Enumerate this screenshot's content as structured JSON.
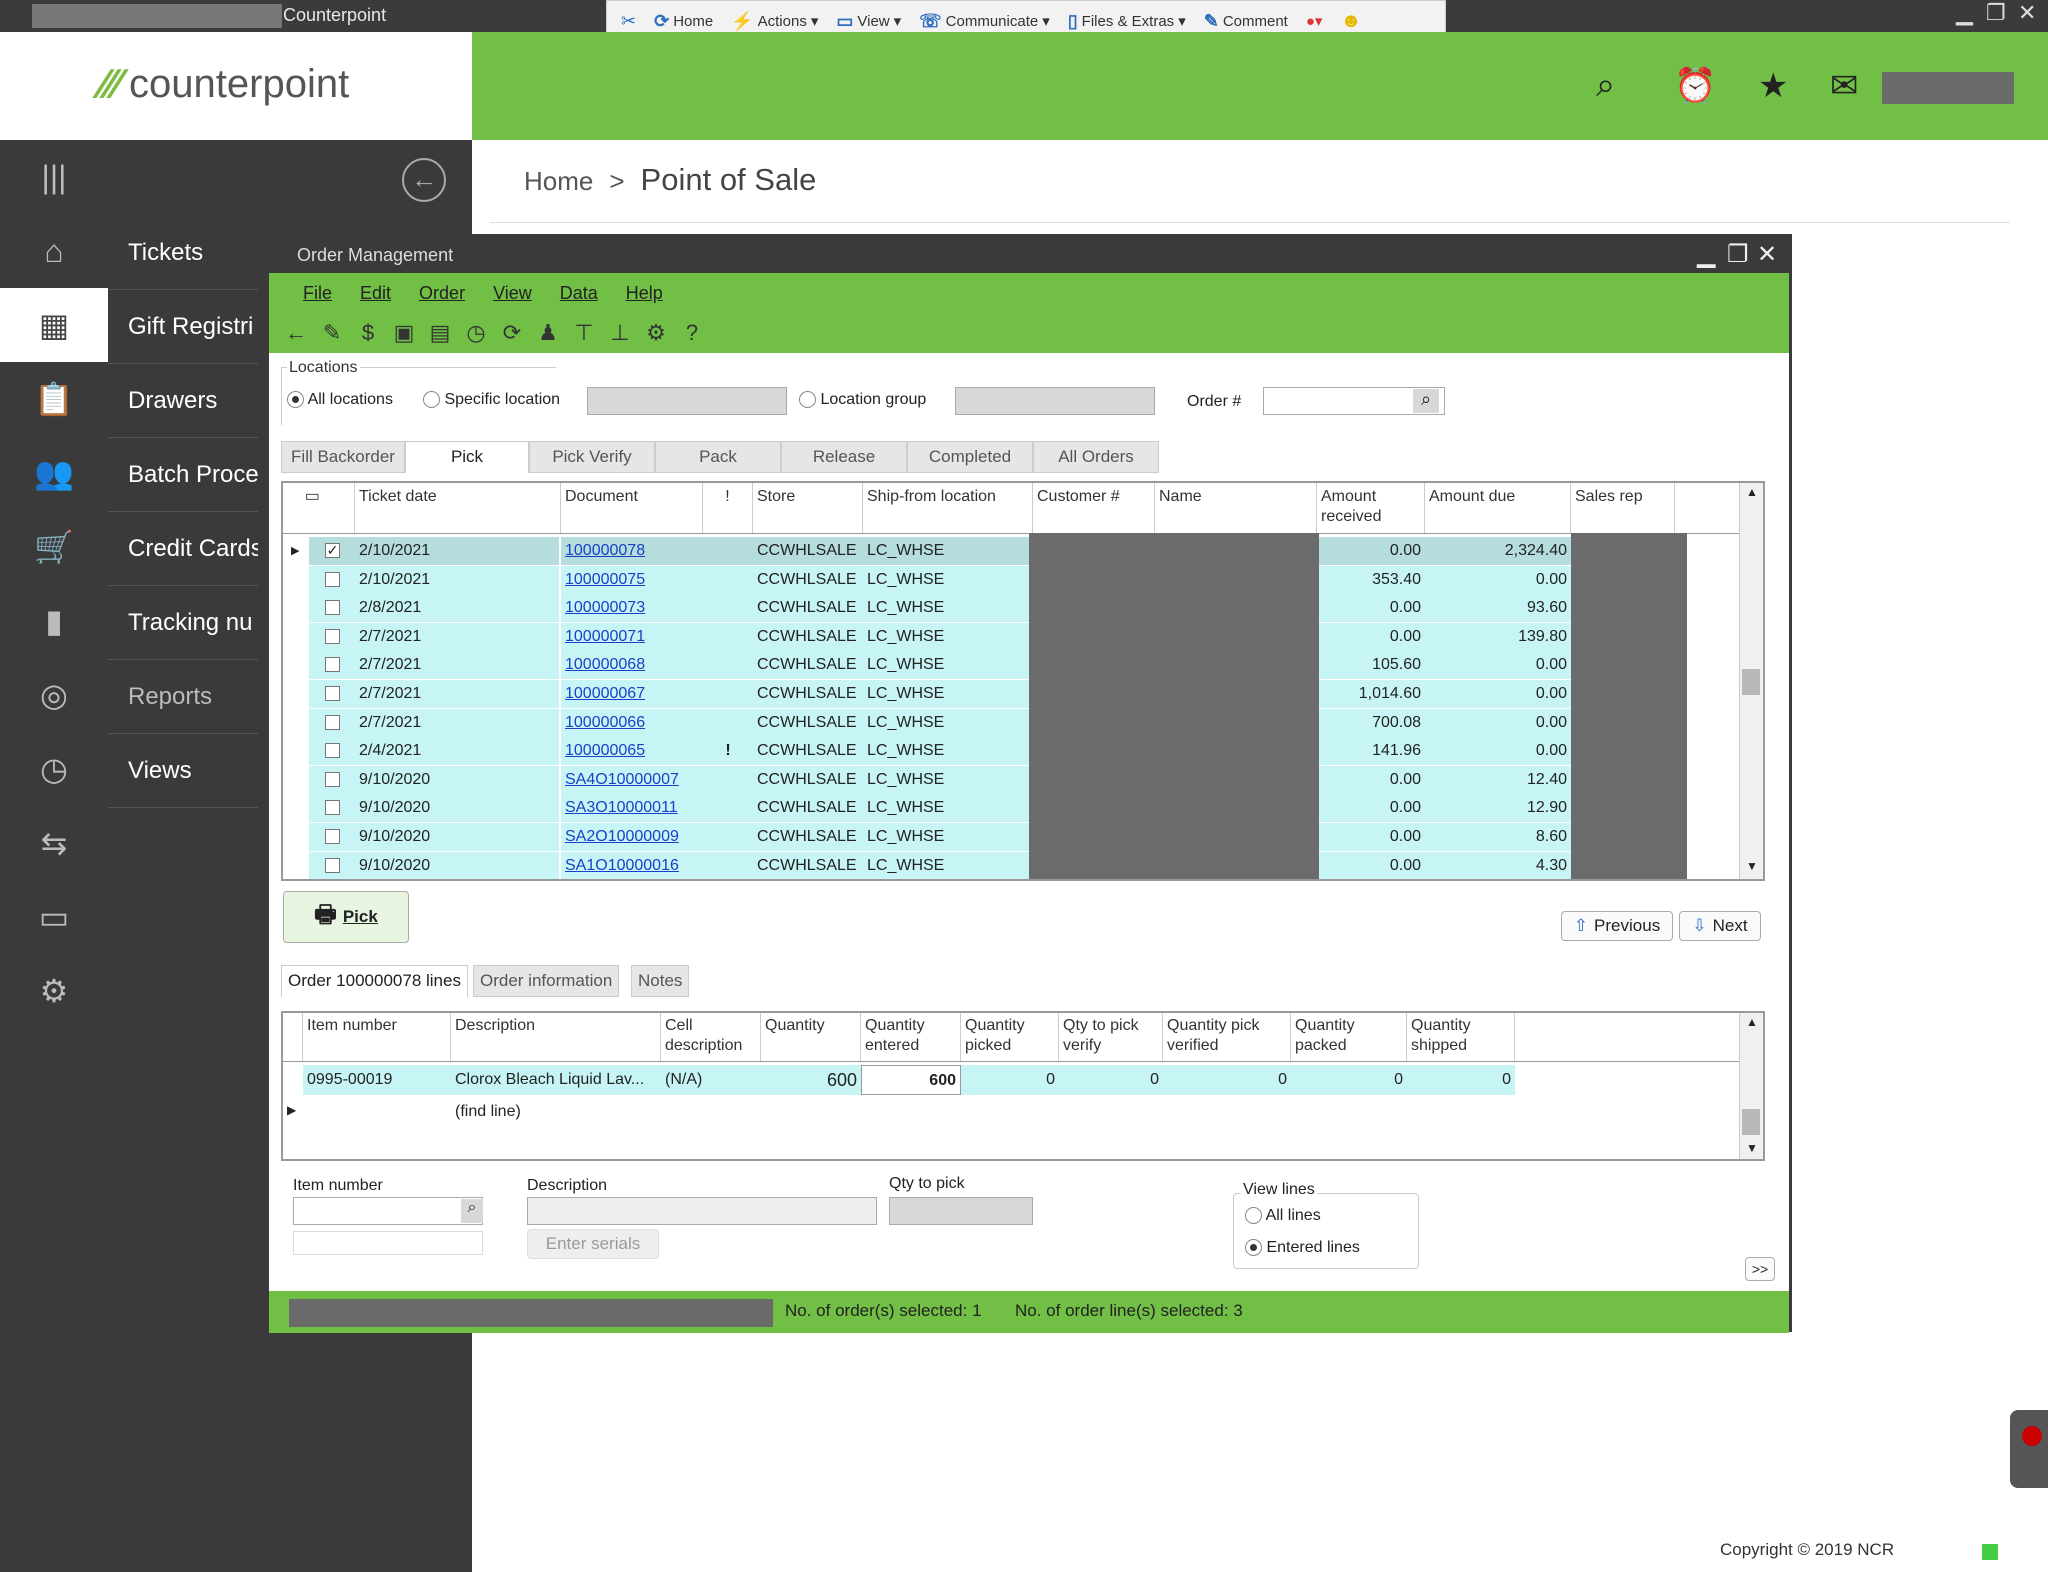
{
  "window": {
    "app_title": "Counterpoint",
    "min": "▁",
    "max": "❐",
    "close": "✕"
  },
  "ctoolbar": {
    "items": [
      "Home",
      "Actions",
      "View",
      "Communicate",
      "Files & Extras",
      "Comment"
    ]
  },
  "logo": {
    "text": "counterpoint",
    "mark": "⁄⁄⁄"
  },
  "header": {
    "icons": [
      "search-icon",
      "alarm-icon",
      "star-icon",
      "mail-icon"
    ]
  },
  "rail": {
    "items": [
      {
        "icon": "menu-icon",
        "glyph": "|||"
      },
      {
        "icon": "home-icon",
        "glyph": "⌂"
      },
      {
        "icon": "register-icon",
        "glyph": "▦"
      },
      {
        "icon": "clipboard-icon",
        "glyph": "📋"
      },
      {
        "icon": "customers-icon",
        "glyph": "👥"
      },
      {
        "icon": "cart-icon",
        "glyph": "🛒"
      },
      {
        "icon": "chart-icon",
        "glyph": "▮"
      },
      {
        "icon": "reports-icon",
        "glyph": "◎"
      },
      {
        "icon": "clock-icon",
        "glyph": "◷"
      },
      {
        "icon": "transfer-icon",
        "glyph": "⇆"
      },
      {
        "icon": "laptop-icon",
        "glyph": "▭"
      },
      {
        "icon": "settings-icon",
        "glyph": "⚙"
      }
    ]
  },
  "nav": {
    "items": [
      "Tickets",
      "Gift Registri",
      "Drawers",
      "Batch Proce",
      "Credit Cards",
      "Tracking nu",
      "Reports",
      "Views"
    ]
  },
  "breadcrumb": {
    "home": "Home",
    "sep": ">",
    "current": "Point of Sale"
  },
  "om": {
    "title": "Order Management",
    "menu": [
      "File",
      "Edit",
      "Order",
      "View",
      "Data",
      "Help"
    ],
    "locations_label": "Locations",
    "all_locations": "All locations",
    "specific_location": "Specific location",
    "location_group": "Location group",
    "order_label": "Order #",
    "tabs": [
      "Fill Backorder",
      "Pick",
      "Pick Verify",
      "Pack",
      "Release",
      "Completed",
      "All Orders"
    ],
    "columns": [
      "Ticket date",
      "Document",
      "!",
      "Store",
      "Ship-from location",
      "Customer #",
      "Name",
      "Amount received",
      "Amount due",
      "Sales rep"
    ],
    "rows": [
      {
        "date": "2/10/2021",
        "doc": "100000078",
        "flag": "",
        "store": "CCWHLSALE",
        "loc": "LC_WHSE",
        "recv": "0.00",
        "due": "2,324.40",
        "checked": "✓"
      },
      {
        "date": "2/10/2021",
        "doc": "100000075",
        "flag": "",
        "store": "CCWHLSALE",
        "loc": "LC_WHSE",
        "recv": "353.40",
        "due": "0.00",
        "checked": ""
      },
      {
        "date": "2/8/2021",
        "doc": "100000073",
        "flag": "",
        "store": "CCWHLSALE",
        "loc": "LC_WHSE",
        "recv": "0.00",
        "due": "93.60",
        "checked": ""
      },
      {
        "date": "2/7/2021",
        "doc": "100000071",
        "flag": "",
        "store": "CCWHLSALE",
        "loc": "LC_WHSE",
        "recv": "0.00",
        "due": "139.80",
        "checked": ""
      },
      {
        "date": "2/7/2021",
        "doc": "100000068",
        "flag": "",
        "store": "CCWHLSALE",
        "loc": "LC_WHSE",
        "recv": "105.60",
        "due": "0.00",
        "checked": ""
      },
      {
        "date": "2/7/2021",
        "doc": "100000067",
        "flag": "",
        "store": "CCWHLSALE",
        "loc": "LC_WHSE",
        "recv": "1,014.60",
        "due": "0.00",
        "checked": ""
      },
      {
        "date": "2/7/2021",
        "doc": "100000066",
        "flag": "",
        "store": "CCWHLSALE",
        "loc": "LC_WHSE",
        "recv": "700.08",
        "due": "0.00",
        "checked": ""
      },
      {
        "date": "2/4/2021",
        "doc": "100000065",
        "flag": "!",
        "store": "CCWHLSALE",
        "loc": "LC_WHSE",
        "recv": "141.96",
        "due": "0.00",
        "checked": ""
      },
      {
        "date": "9/10/2020",
        "doc": "SA4O10000007",
        "flag": "",
        "store": "CCWHLSALE",
        "loc": "LC_WHSE",
        "recv": "0.00",
        "due": "12.40",
        "checked": ""
      },
      {
        "date": "9/10/2020",
        "doc": "SA3O10000011",
        "flag": "",
        "store": "CCWHLSALE",
        "loc": "LC_WHSE",
        "recv": "0.00",
        "due": "12.90",
        "checked": ""
      },
      {
        "date": "9/10/2020",
        "doc": "SA2O10000009",
        "flag": "",
        "store": "CCWHLSALE",
        "loc": "LC_WHSE",
        "recv": "0.00",
        "due": "8.60",
        "checked": ""
      },
      {
        "date": "9/10/2020",
        "doc": "SA1O10000016",
        "flag": "",
        "store": "CCWHLSALE",
        "loc": "LC_WHSE",
        "recv": "0.00",
        "due": "4.30",
        "checked": ""
      }
    ],
    "pick_button": "Pick",
    "previous": "Previous",
    "next": "Next",
    "lower_tabs": [
      "Order 100000078 lines",
      "Order information",
      "Notes"
    ],
    "line_columns": [
      "Item number",
      "Description",
      "Cell description",
      "Quantity",
      "Quantity entered",
      "Quantity picked",
      "Qty to pick verify",
      "Quantity pick verified",
      "Quantity packed",
      "Quantity shipped"
    ],
    "line": {
      "item": "0995-00019",
      "desc": "Clorox Bleach Liquid Lav...",
      "cell": "(N/A)",
      "qty": "600",
      "entered": "600",
      "picked": "0",
      "verify": "0",
      "verified": "0",
      "packed": "0",
      "shipped": "0"
    },
    "find_line": "(find line)",
    "item_number_label": "Item number",
    "description_label": "Description",
    "qty_to_pick_label": "Qty to pick",
    "enter_serials": "Enter serials",
    "view_lines_label": "View lines",
    "all_lines": "All lines",
    "entered_lines": "Entered lines",
    "more": ">>",
    "status_orders": "No. of order(s) selected: 1",
    "status_lines": "No. of order line(s) selected: 3"
  },
  "footer": {
    "copyright": "Copyright © 2019 NCR"
  },
  "colors": {
    "green": "#71bf44",
    "dark": "#3a3a3a",
    "cyan": "#c7f5f5"
  }
}
